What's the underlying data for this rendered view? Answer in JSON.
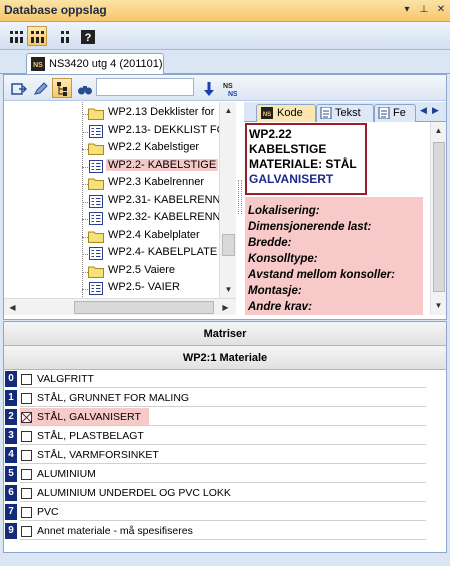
{
  "window": {
    "title": "Database oppslag",
    "controls": [
      "▾",
      "⊥",
      "✕"
    ]
  },
  "doc_tab": {
    "label": "NS3420 utg 4 (201101)"
  },
  "tree": {
    "items": [
      {
        "label": "WP2.13 Dekklister for",
        "type": "folder"
      },
      {
        "label": "WP2.13- DEKKLIST FO",
        "type": "code"
      },
      {
        "label": "WP2.2 Kabelstiger",
        "type": "folder"
      },
      {
        "label": "WP2.2- KABELSTIGE",
        "type": "code",
        "selected": true
      },
      {
        "label": "WP2.3 Kabelrenner",
        "type": "folder"
      },
      {
        "label": "WP2.31- KABELRENN",
        "type": "code"
      },
      {
        "label": "WP2.32- KABELRENN",
        "type": "code"
      },
      {
        "label": "WP2.4 Kabelplater",
        "type": "folder"
      },
      {
        "label": "WP2.4- KABELPLATE",
        "type": "code"
      },
      {
        "label": "WP2.5 Vaiere",
        "type": "folder"
      },
      {
        "label": "WP2.5- VAIER",
        "type": "code"
      }
    ]
  },
  "right_tabs": [
    {
      "label": "Kode",
      "active": true
    },
    {
      "label": "Tekst",
      "active": false
    },
    {
      "label": "Fe",
      "active": false
    }
  ],
  "code_box": {
    "lines": [
      "WP2.22",
      "KABELSTIGE",
      "MATERIALE: STÅL",
      "GALVANISERT"
    ]
  },
  "fields": [
    "Lokalisering:",
    "Dimensjonerende last:",
    "Bredde:",
    "Konsolltype:",
    "Avstand mellom konsoller:",
    "Montasje:",
    "Andre krav:"
  ],
  "matrix": {
    "header": "Matriser",
    "subheader": "WP2:1 Materiale",
    "rows": [
      {
        "num": "0",
        "label": "VALGFRITT",
        "checked": false
      },
      {
        "num": "1",
        "label": "STÅL, GRUNNET FOR MALING",
        "checked": false
      },
      {
        "num": "2",
        "label": "STÅL, GALVANISERT",
        "checked": true
      },
      {
        "num": "3",
        "label": "STÅL, PLASTBELAGT",
        "checked": false
      },
      {
        "num": "4",
        "label": "STÅL, VARMFORSINKET",
        "checked": false
      },
      {
        "num": "5",
        "label": "ALUMINIUM",
        "checked": false
      },
      {
        "num": "6",
        "label": "ALUMINIUM UNDERDEL OG PVC LOKK",
        "checked": false
      },
      {
        "num": "7",
        "label": "PVC",
        "checked": false
      },
      {
        "num": "9",
        "label": "Annet materiale - må spesifiseres",
        "checked": false
      }
    ]
  },
  "icons": {
    "toolbar1": [
      "view-grid-icon",
      "view-grid-active-icon",
      "view-small-icon",
      "help-icon"
    ],
    "toolbar2": [
      "export-icon",
      "edit-icon",
      "tree-view-icon",
      "binoculars-icon",
      "down-arrow-icon",
      "ns-ns-icon"
    ]
  },
  "colors": {
    "accent": "#f6c76b",
    "selection": "#f5c9c9",
    "number_badge": "#132b7b",
    "code_border": "#9b1c2a"
  }
}
